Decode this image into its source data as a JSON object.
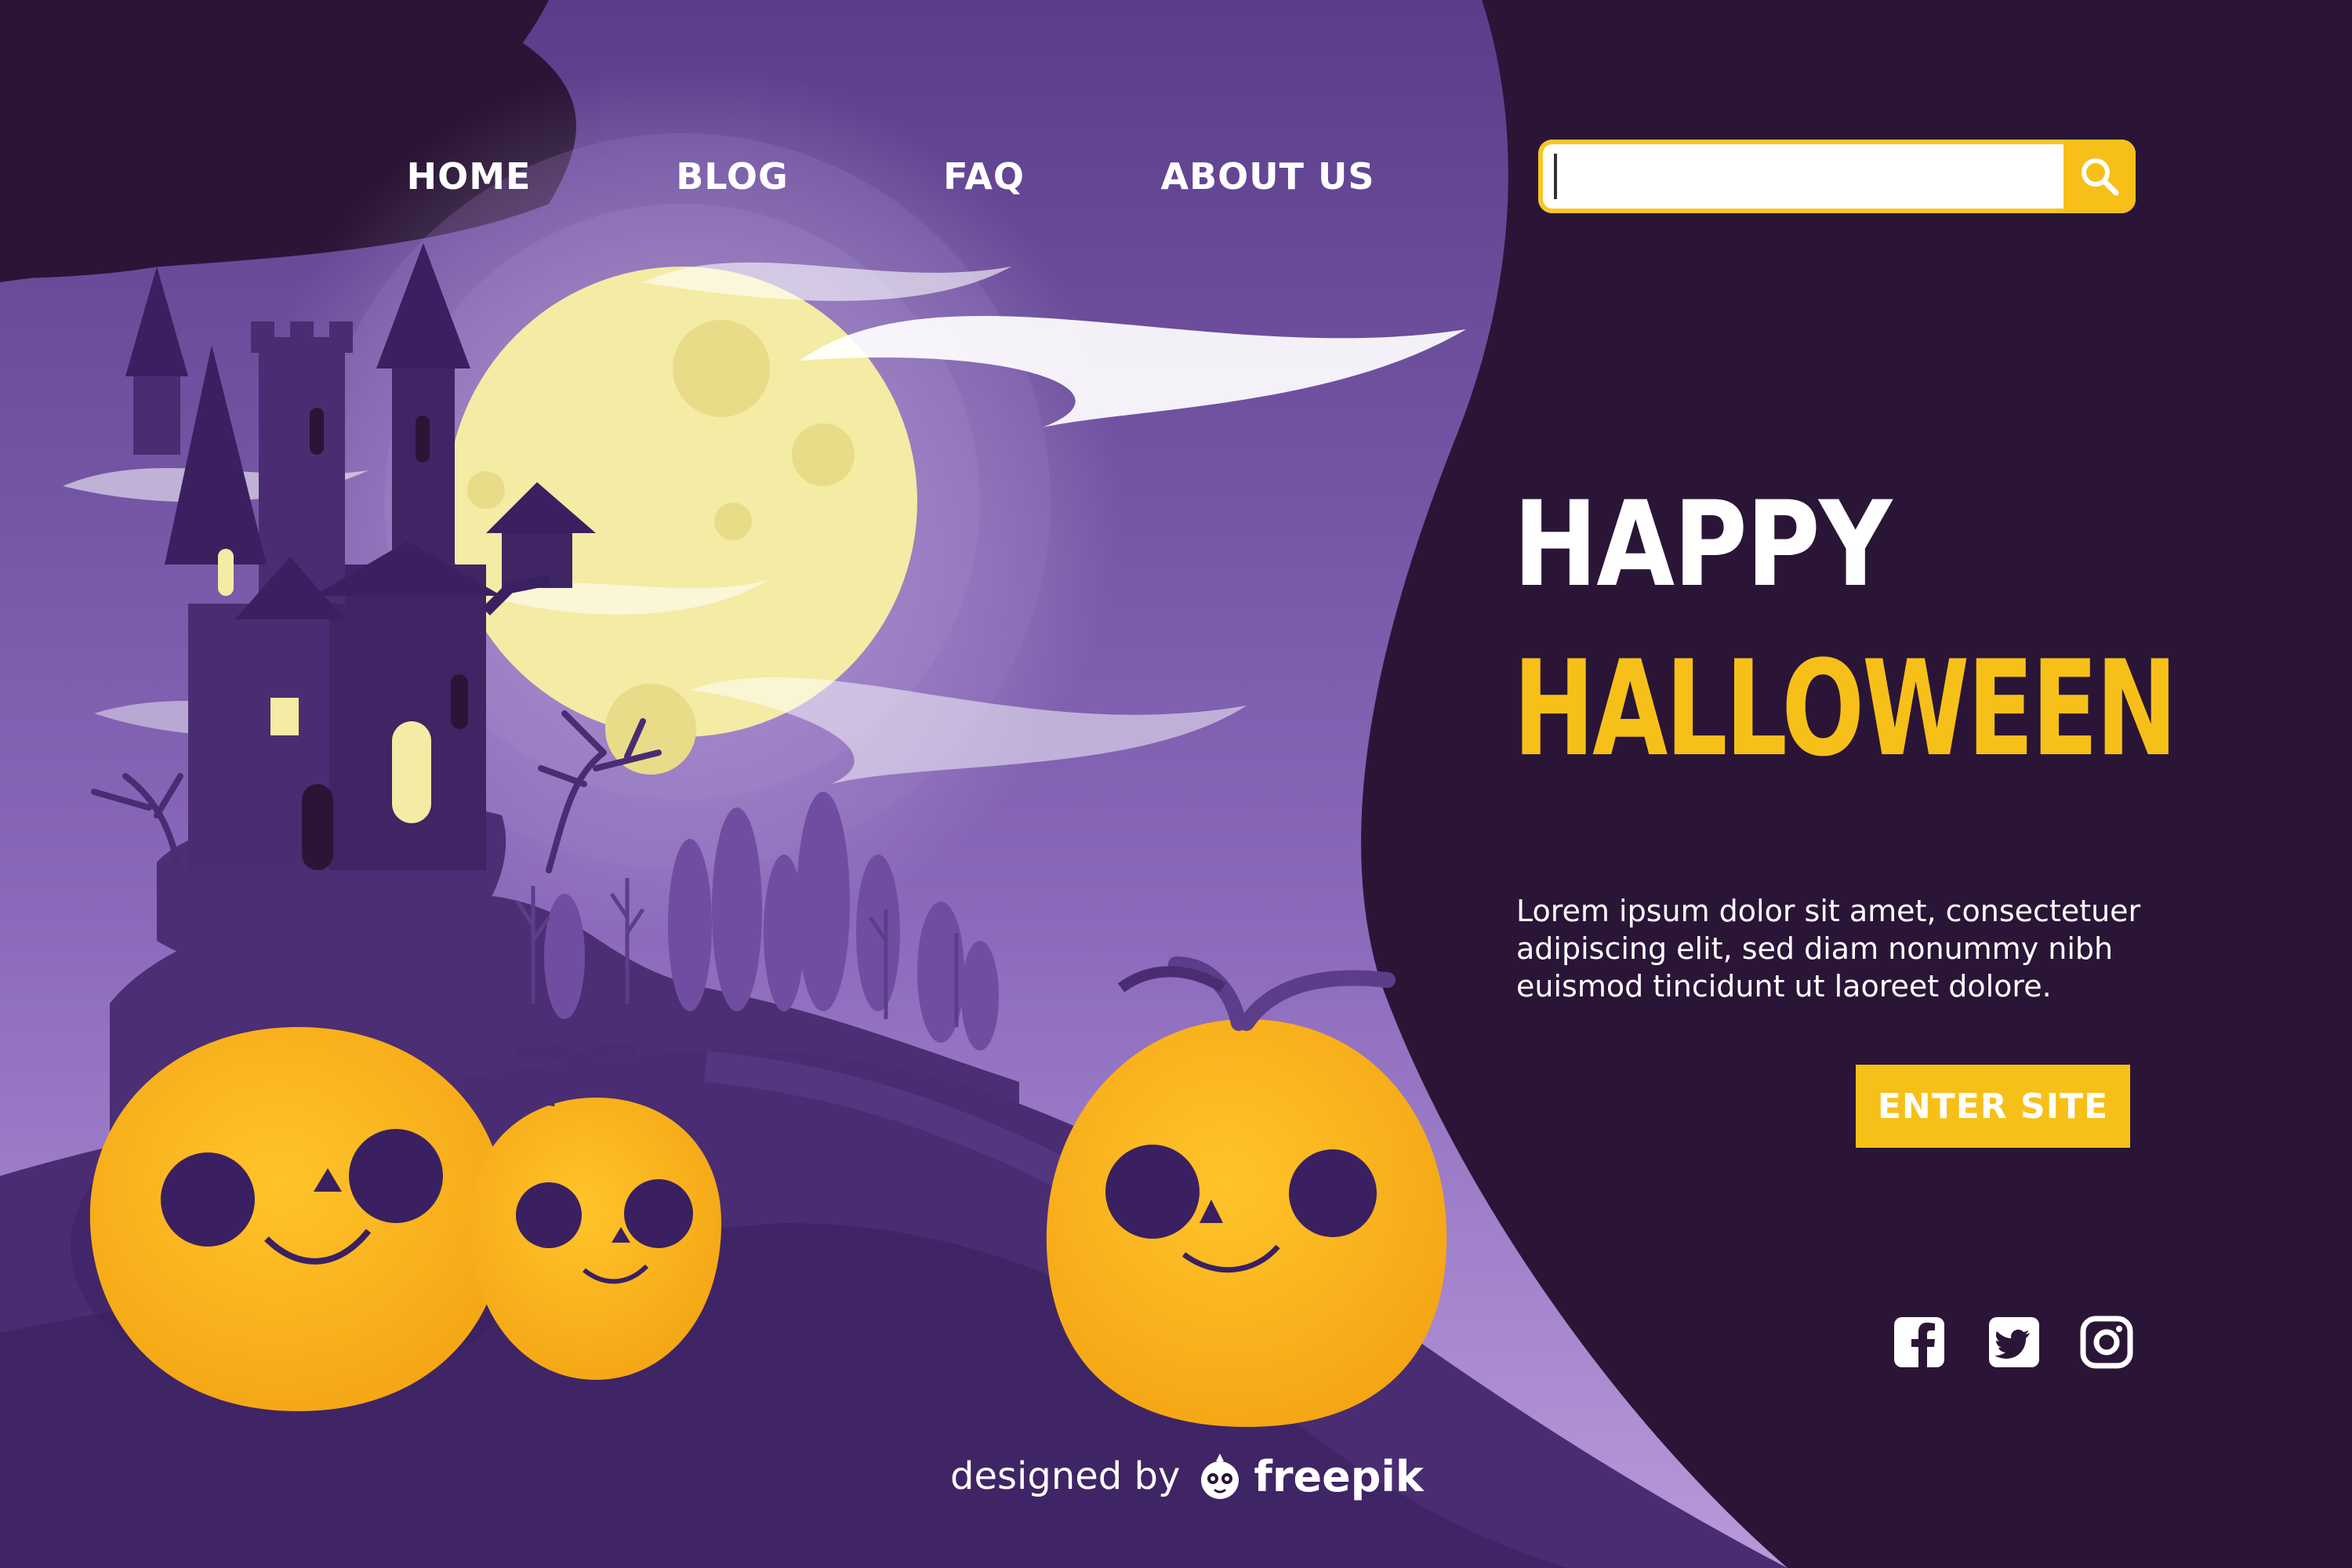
{
  "nav": {
    "items": [
      {
        "label": "HOME"
      },
      {
        "label": "BLOG"
      },
      {
        "label": "FAQ"
      },
      {
        "label": "ABOUT US"
      }
    ]
  },
  "search": {
    "value": "",
    "placeholder": "",
    "button_icon": "search-icon"
  },
  "hero": {
    "title_line1": "HAPPY",
    "title_line2": "HALLOWEEN",
    "body": "Lorem ipsum dolor sit amet, consectetuer adipiscing elit, sed diam nonummy nibh euismod tincidunt ut laoreet dolore.",
    "cta_label": "ENTER SITE"
  },
  "social": {
    "icons": [
      "facebook-icon",
      "twitter-icon",
      "instagram-icon"
    ]
  },
  "credit": {
    "prefix": "designed by",
    "brand": "freepik"
  },
  "colors": {
    "background": "#2a1537",
    "panel_purple": "#6a4a9a",
    "accent_yellow": "#f7c018",
    "moon": "#f4eba4",
    "text": "#ffffff"
  }
}
